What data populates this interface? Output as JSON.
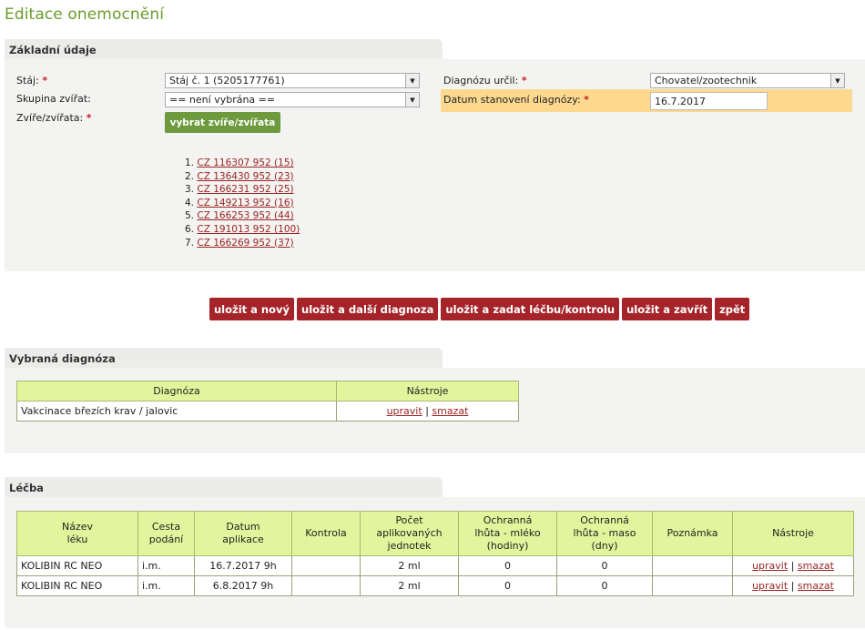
{
  "page": {
    "title": "Editace onemocnění"
  },
  "basic": {
    "header": "Základní údaje",
    "stable_label": "Stáj:",
    "stable_value": "Stáj č. 1 (5205177761)",
    "group_label": "Skupina zvířat:",
    "group_value": "== není vybrána ==",
    "animals_label": "Zvíře/zvířata:",
    "select_animals_button": "vybrat zvíře/zvířata",
    "animals": [
      {
        "num": "1.",
        "id": "CZ 116307 952 (15)"
      },
      {
        "num": "2.",
        "id": "CZ 136430 952 (23)"
      },
      {
        "num": "3.",
        "id": "CZ 166231 952 (25)"
      },
      {
        "num": "4.",
        "id": "CZ 149213 952 (16)"
      },
      {
        "num": "5.",
        "id": "CZ 166253 952 (44)"
      },
      {
        "num": "6.",
        "id": "CZ 191013 952 (100)"
      },
      {
        "num": "7.",
        "id": "CZ 166269 952 (37)"
      }
    ],
    "diagnosed_by_label": "Diagnózu určil:",
    "diagnosed_by_value": "Chovatel/zootechnik",
    "diagnosis_date_label": "Datum stanovení diagnózy:",
    "diagnosis_date_value": "16.7.2017",
    "required_mark": "*"
  },
  "actions": {
    "save_new": "uložit a nový",
    "save_next_diagnosis": "uložit a další diagnoza",
    "save_treatment": "uložit a zadat léčbu/kontrolu",
    "save_close": "uložit a zavřít",
    "back": "zpět"
  },
  "diagnosis": {
    "header": "Vybraná diagnóza",
    "columns": [
      "Diagnóza",
      "Nástroje"
    ],
    "rows": [
      {
        "name": "Vakcinace březích krav / jalovic",
        "edit": "upravit",
        "delete": "smazat"
      }
    ]
  },
  "treatment": {
    "header": "Léčba",
    "columns": {
      "name": [
        "Název",
        "léku"
      ],
      "route": [
        "Cesta",
        "podání"
      ],
      "date": [
        "Datum",
        "aplikace"
      ],
      "control": [
        "Kontrola"
      ],
      "units": [
        "Počet",
        "aplikovaných",
        "jednotek"
      ],
      "milk": [
        "Ochranná",
        "lhůta - mléko",
        "(hodiny)"
      ],
      "meat": [
        "Ochranná",
        "lhůta - maso",
        "(dny)"
      ],
      "note": [
        "Poznámka"
      ],
      "tools": [
        "Nástroje"
      ]
    },
    "rows": [
      {
        "name": "KOLIBIN RC NEO",
        "route": "i.m.",
        "date": "16.7.2017 9h",
        "control": "",
        "units": "2 ml",
        "milk": "0",
        "meat": "0",
        "note": "",
        "edit": "upravit",
        "delete": "smazat"
      },
      {
        "name": "KOLIBIN RC NEO",
        "route": "i.m.",
        "date": "6.8.2017 9h",
        "control": "",
        "units": "2 ml",
        "milk": "0",
        "meat": "0",
        "note": "",
        "edit": "upravit",
        "delete": "smazat"
      }
    ]
  },
  "separator": "|"
}
